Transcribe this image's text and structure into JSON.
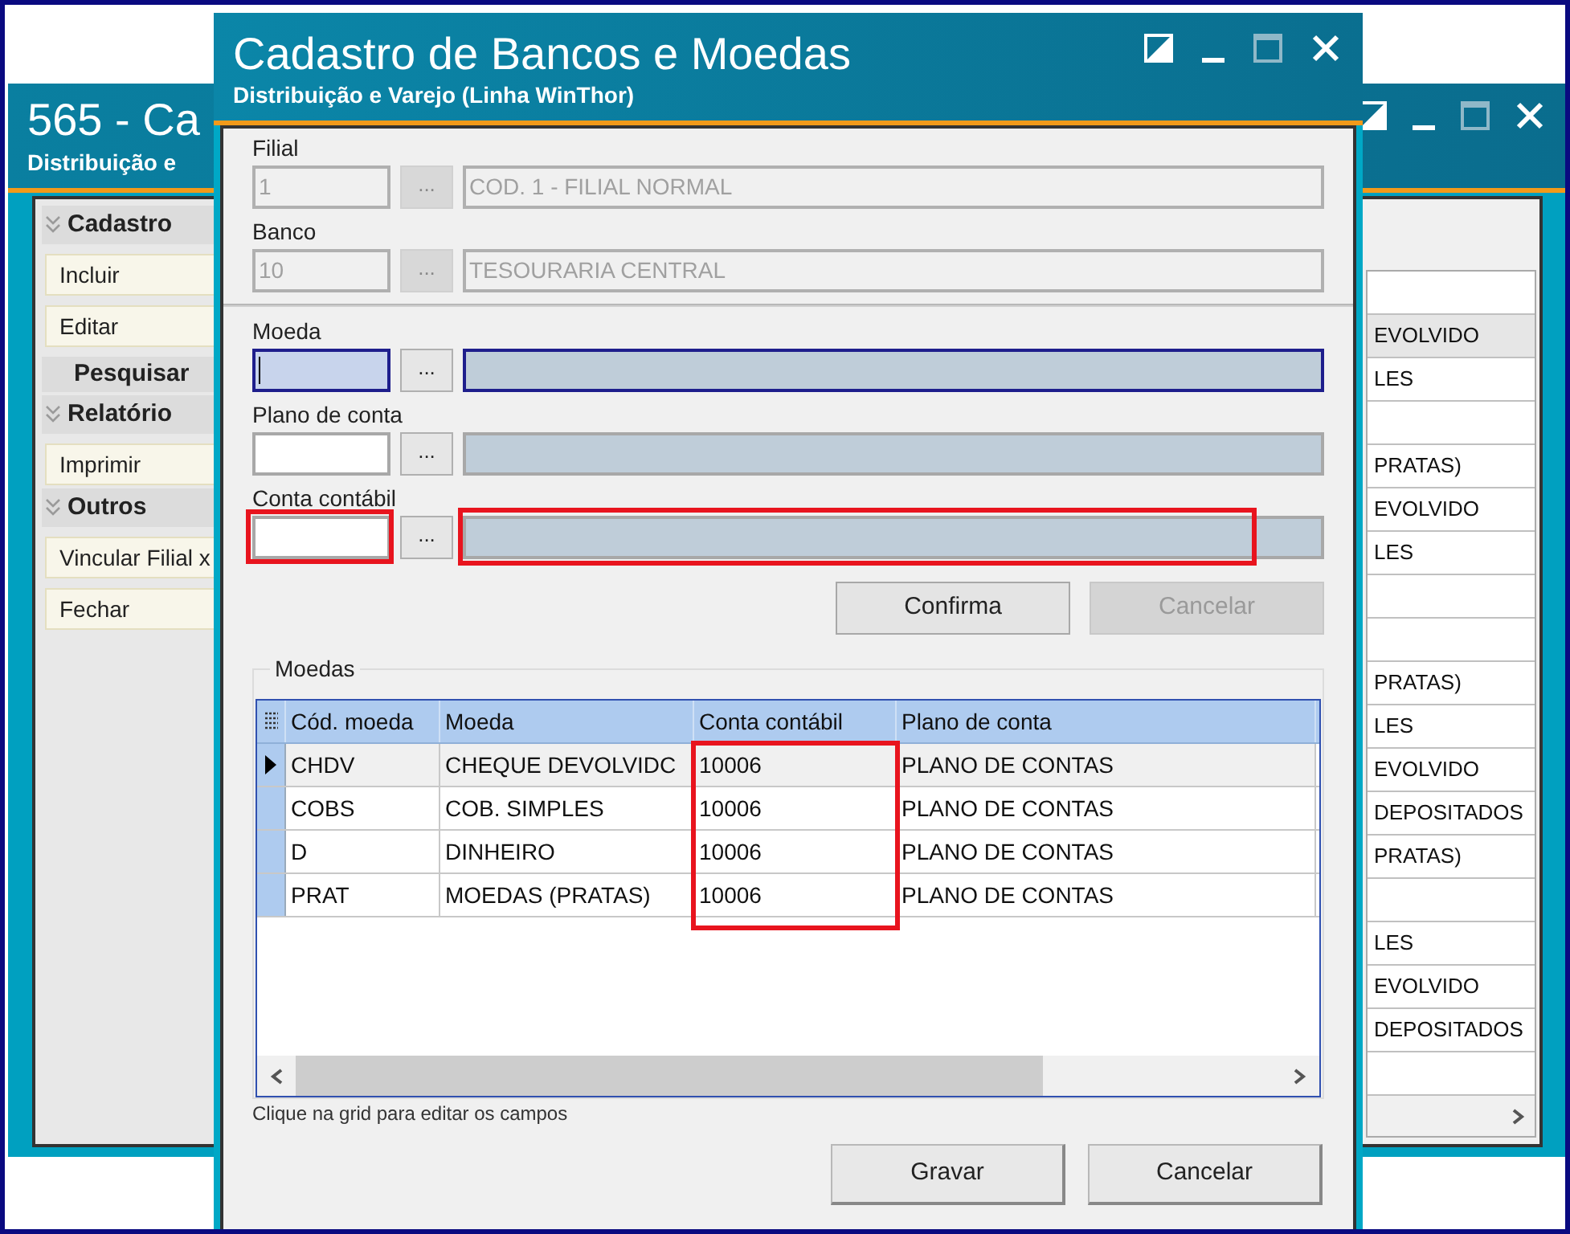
{
  "background_window": {
    "title": "565 - Ca",
    "subtitle": "Distribuição e",
    "sidebar": [
      {
        "kind": "group",
        "label": "Cadastro",
        "items": [
          "Incluir",
          "Editar"
        ]
      },
      {
        "kind": "action",
        "label": "Pesquisar"
      },
      {
        "kind": "group",
        "label": "Relatório",
        "items": [
          "Imprimir"
        ]
      },
      {
        "kind": "group",
        "label": "Outros",
        "items": [
          "Vincular Filial x",
          "Fechar"
        ]
      }
    ],
    "grid_rows": [
      {
        "kind": "empty",
        "selected": false
      },
      {
        "kind": "text",
        "text": "EVOLVIDO",
        "selected": true
      },
      {
        "kind": "text",
        "text": "LES",
        "selected": false
      },
      {
        "kind": "empty",
        "selected": false
      },
      {
        "kind": "text",
        "text": "PRATAS)",
        "selected": false
      },
      {
        "kind": "text",
        "text": "EVOLVIDO",
        "selected": false
      },
      {
        "kind": "text",
        "text": "LES",
        "selected": false
      },
      {
        "kind": "empty",
        "selected": false
      },
      {
        "kind": "empty",
        "selected": false
      },
      {
        "kind": "text",
        "text": "PRATAS)",
        "selected": false
      },
      {
        "kind": "text",
        "text": "LES",
        "selected": false
      },
      {
        "kind": "text",
        "text": "EVOLVIDO",
        "selected": false
      },
      {
        "kind": "text",
        "text": "DEPOSITADOS",
        "selected": false
      },
      {
        "kind": "text",
        "text": "PRATAS)",
        "selected": false
      },
      {
        "kind": "empty",
        "selected": false
      },
      {
        "kind": "text",
        "text": "LES",
        "selected": false
      },
      {
        "kind": "text",
        "text": "EVOLVIDO",
        "selected": false
      },
      {
        "kind": "text",
        "text": "DEPOSITADOS",
        "selected": false
      },
      {
        "kind": "empty",
        "selected": false
      }
    ]
  },
  "dialog": {
    "title": "Cadastro de Bancos e Moedas",
    "subtitle": "Distribuição e Varejo (Linha WinThor)",
    "fields": [
      {
        "label": "Filial",
        "code": "1",
        "description": "COD. 1 - FILIAL NORMAL",
        "disabled": true,
        "focused": false,
        "highlighted": false
      },
      {
        "label": "Banco",
        "code": "10",
        "description": "TESOURARIA CENTRAL",
        "disabled": true,
        "focused": false,
        "highlighted": false
      },
      {
        "label": "Moeda",
        "disabled": false,
        "focused": true,
        "highlighted": false
      },
      {
        "label": "Plano de conta",
        "disabled": false,
        "focused": false,
        "highlighted": false
      },
      {
        "label": "Conta contábil",
        "disabled": false,
        "focused": false,
        "highlighted": true
      }
    ],
    "lookup_button": "...",
    "buttons": [
      {
        "label": "Confirma",
        "disabled": false
      },
      {
        "label": "Cancelar",
        "disabled": true
      }
    ],
    "grid": {
      "title": "Moedas",
      "columns": [
        {
          "label": "Cód. moeda",
          "highlighted": false
        },
        {
          "label": "Moeda",
          "highlighted": false
        },
        {
          "label": "Conta contábil",
          "highlighted": true
        },
        {
          "label": "Plano de conta",
          "highlighted": false
        }
      ],
      "rows": [
        {
          "selected": true,
          "cells": [
            "CHDV",
            "CHEQUE DEVOLVIDC",
            "10006",
            "PLANO DE CONTAS"
          ]
        },
        {
          "selected": false,
          "cells": [
            "COBS",
            "COB. SIMPLES",
            "10006",
            "PLANO DE CONTAS"
          ]
        },
        {
          "selected": false,
          "cells": [
            "D",
            "DINHEIRO",
            "10006",
            "PLANO DE CONTAS"
          ]
        },
        {
          "selected": false,
          "cells": [
            "PRAT",
            "MOEDAS (PRATAS)",
            "10006",
            "PLANO DE CONTAS"
          ]
        }
      ],
      "hint": "Clique na grid para editar os campos"
    },
    "footer_buttons": [
      "Gravar",
      "Cancelar"
    ]
  }
}
